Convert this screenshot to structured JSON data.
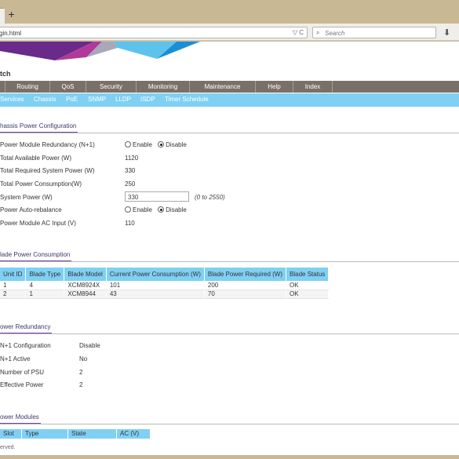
{
  "browser": {
    "new_tab_label": "+",
    "url": "gin.html",
    "url_icons": "▽ C",
    "search_placeholder": "Search",
    "download_icon": "download-icon"
  },
  "app": {
    "title": "tch"
  },
  "main_menu": [
    "",
    "Routing",
    "QoS",
    "Security",
    "Monitoring",
    "Maintenance",
    "Help",
    "Index"
  ],
  "sub_menu": [
    {
      "label": "Services",
      "active": false
    },
    {
      "label": "Chassis",
      "active": true
    },
    {
      "label": "PoE",
      "active": false
    },
    {
      "label": "SNMP",
      "active": false
    },
    {
      "label": "LLDP",
      "active": false
    },
    {
      "label": "ISDP",
      "active": false
    },
    {
      "label": "Timer Schedule",
      "active": false
    }
  ],
  "chassis_power": {
    "title": "hassis Power Configuration",
    "redundancy": {
      "label": "Power Module Redundancy (N+1)",
      "enable": "Enable",
      "disable": "Disable",
      "selected": "Disable"
    },
    "available": {
      "label": "Total Available Power (W)",
      "value": "1120"
    },
    "required": {
      "label": "Total Required System Power (W)",
      "value": "330"
    },
    "consumption": {
      "label": "Total Power Consumption(W)",
      "value": "250"
    },
    "system_power": {
      "label": "System Power (W)",
      "value": "330",
      "hint": "(0 to 2550)"
    },
    "auto_rebalance": {
      "label": "Power Auto-rebalance",
      "enable": "Enable",
      "disable": "Disable",
      "selected": "Disable"
    },
    "ac_input": {
      "label": "Power Module AC Input (V)",
      "value": "110"
    }
  },
  "blade_power": {
    "title": "lade Power Consumption",
    "columns": [
      "Unit ID",
      "Blade Type",
      "Blade Model",
      "Current Power Consumption (W)",
      "Blade Power Required (W)",
      "Blade Status"
    ],
    "rows": [
      [
        "1",
        "4",
        "XCM8924X",
        "101",
        "200",
        "OK"
      ],
      [
        "2",
        "1",
        "XCM8944",
        "43",
        "70",
        "OK"
      ]
    ]
  },
  "power_redundancy": {
    "title": "ower Redundancy",
    "items": [
      {
        "label": "N+1 Configuration",
        "value": "Disable"
      },
      {
        "label": "N+1 Active",
        "value": "No"
      },
      {
        "label": "Number of PSU",
        "value": "2"
      },
      {
        "label": "Effective Power",
        "value": "2"
      }
    ]
  },
  "power_modules": {
    "title": "ower Modules",
    "columns": [
      "Slot",
      "Type",
      "State",
      "AC (V)"
    ]
  },
  "footer": {
    "text": "erved."
  },
  "colors": {
    "menu_bg": "#7b7067",
    "submenu_bg": "#7fd0f3",
    "accent": "#7a3ea0"
  }
}
